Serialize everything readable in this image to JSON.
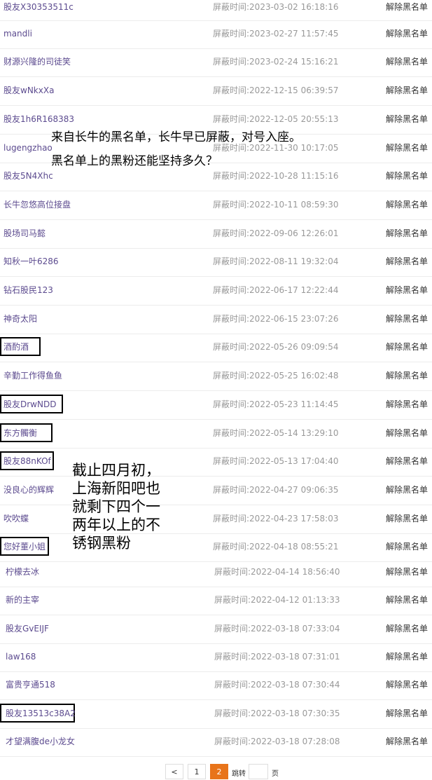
{
  "rows": [
    {
      "name": "股友X30353511c",
      "time_label": "屏蔽时间:",
      "time": "2023-03-02 16:18:16",
      "action": "解除黑名单"
    },
    {
      "name": "mandli",
      "time_label": "屏蔽时间:",
      "time": "2023-02-27 11:57:45",
      "action": "解除黑名单"
    },
    {
      "name": "财源兴隆的司徒笑",
      "time_label": "屏蔽时间:",
      "time": "2023-02-24 15:16:21",
      "action": "解除黑名单"
    },
    {
      "name": "股友wNkxXa",
      "time_label": "屏蔽时间:",
      "time": "2022-12-15 06:39:57",
      "action": "解除黑名单"
    },
    {
      "name": "股友1h6R168383",
      "time_label": "屏蔽时间:",
      "time": "2022-12-05 20:55:13",
      "action": "解除黑名单"
    },
    {
      "name": "lugengzhao",
      "time_label": "屏蔽时间:",
      "time": "2022-11-30 10:17:05",
      "action": "解除黑名单"
    },
    {
      "name": "股友5N4Xhc",
      "time_label": "屏蔽时间:",
      "time": "2022-10-28 11:15:16",
      "action": "解除黑名单"
    },
    {
      "name": "长牛忽悠高位接盘",
      "time_label": "屏蔽时间:",
      "time": "2022-10-11 08:59:30",
      "action": "解除黑名单"
    },
    {
      "name": "股场司马懿",
      "time_label": "屏蔽时间:",
      "time": "2022-09-06 12:26:01",
      "action": "解除黑名单"
    },
    {
      "name": "知秋一叶6286",
      "time_label": "屏蔽时间:",
      "time": "2022-08-11 19:32:04",
      "action": "解除黑名单"
    },
    {
      "name": "钻石股民123",
      "time_label": "屏蔽时间:",
      "time": "2022-06-17 12:22:44",
      "action": "解除黑名单"
    },
    {
      "name": "神奇太阳",
      "time_label": "屏蔽时间:",
      "time": "2022-06-15 23:07:26",
      "action": "解除黑名单"
    },
    {
      "name": "酒酌酒",
      "time_label": "屏蔽时间:",
      "time": "2022-05-26 09:09:54",
      "action": "解除黑名单"
    },
    {
      "name": "辛勤工作得鱼鱼",
      "time_label": "屏蔽时间:",
      "time": "2022-05-25 16:02:48",
      "action": "解除黑名单"
    },
    {
      "name": "股友DrwNDD",
      "time_label": "屏蔽时间:",
      "time": "2022-05-23 11:14:45",
      "action": "解除黑名单"
    },
    {
      "name": "东方髑衡",
      "time_label": "屏蔽时间:",
      "time": "2022-05-14 13:29:10",
      "action": "解除黑名单"
    },
    {
      "name": "股友88nKOf",
      "time_label": "屏蔽时间:",
      "time": "2022-05-13 17:04:40",
      "action": "解除黑名单"
    },
    {
      "name": "没良心的辉辉",
      "time_label": "屏蔽时间:",
      "time": "2022-04-27 09:06:35",
      "action": "解除黑名单"
    },
    {
      "name": "吹吹蝶",
      "time_label": "屏蔽时间:",
      "time": "2022-04-23 17:58:03",
      "action": "解除黑名单"
    },
    {
      "name": "您好董小姐",
      "time_label": "屏蔽时间:",
      "time": "2022-04-18 08:55:21",
      "action": "解除黑名单"
    },
    {
      "name": "柠檬去冰",
      "time_label": "屏蔽时间:",
      "time": "2022-04-14 18:56:40",
      "action": "解除黑名单"
    },
    {
      "name": "新的主宰",
      "time_label": "屏蔽时间:",
      "time": "2022-04-12 01:13:33",
      "action": "解除黑名单"
    },
    {
      "name": "股友GvEIJF",
      "time_label": "屏蔽时间:",
      "time": "2022-03-18 07:33:04",
      "action": "解除黑名单"
    },
    {
      "name": "law168",
      "time_label": "屏蔽时间:",
      "time": "2022-03-18 07:31:01",
      "action": "解除黑名单"
    },
    {
      "name": "富贵亨通518",
      "time_label": "屏蔽时间:",
      "time": "2022-03-18 07:30:44",
      "action": "解除黑名单"
    },
    {
      "name": "股友13513c38A2",
      "time_label": "屏蔽时间:",
      "time": "2022-03-18 07:30:35",
      "action": "解除黑名单"
    },
    {
      "name": "才望满腹de小龙女",
      "time_label": "屏蔽时间:",
      "time": "2022-03-18 07:28:08",
      "action": "解除黑名单"
    }
  ],
  "annotation_top": {
    "line1": "来自长牛的黑名单，长牛早已屏蔽，对号入座。",
    "line2": "黑名单上的黑粉还能坚持多久？"
  },
  "annotation_side": {
    "line1": "截止四月初，",
    "line2": "上海新阳吧也",
    "line3": "就剩下四个一",
    "line4": "两年以上的不",
    "line5": "锈钢黑粉"
  },
  "pagination": {
    "prev": "<",
    "page1": "1",
    "page2": "2",
    "jump_label": "跳转",
    "page_suffix": "页"
  },
  "colors": {
    "username": "#5c4b8f",
    "accent": "#e8741a"
  }
}
